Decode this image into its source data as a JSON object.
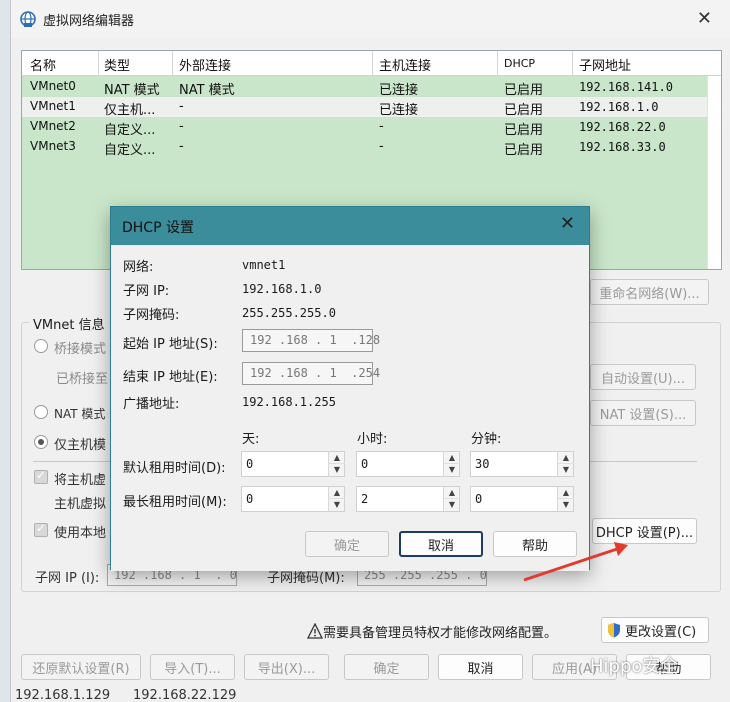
{
  "window": {
    "title": "虚拟网络编辑器",
    "close": "✕"
  },
  "table": {
    "headers": [
      "名称",
      "类型",
      "外部连接",
      "主机连接",
      "DHCP",
      "子网地址"
    ],
    "rows": [
      [
        "VMnet0",
        "NAT 模式",
        "NAT 模式",
        "已连接",
        "已启用",
        "192.168.141.0"
      ],
      [
        "VMnet1",
        "仅主机...",
        "-",
        "已连接",
        "已启用",
        "192.168.1.0"
      ],
      [
        "VMnet2",
        "自定义...",
        "-",
        "-",
        "已启用",
        "192.168.22.0"
      ],
      [
        "VMnet3",
        "自定义...",
        "-",
        "-",
        "已启用",
        "192.168.33.0"
      ]
    ]
  },
  "side_buttons": {
    "rename": "重命名网络(W)...",
    "auto": "自动设置(U)...",
    "nat": "NAT 设置(S)...",
    "dhcp": "DHCP 设置(P)..."
  },
  "vmnet_info": {
    "title": "VMnet 信息",
    "bridge": "桥接模式",
    "bridged_to": "已桥接至",
    "nat": "NAT 模式",
    "host_only": "仅主机模",
    "connect_host": "将主机虚",
    "host_virtual": "主机虚拟",
    "use_local": "使用本地",
    "subnet_ip_label": "子网 IP (I):",
    "subnet_ip_value": "192 .168 . 1  . 0",
    "mask_label": "子网掩码(M):",
    "mask_value": "255 .255 .255 . 0"
  },
  "admin": {
    "notice": "需要具备管理员特权才能修改网络配置。",
    "change": "更改设置(C)"
  },
  "bottom_buttons": {
    "restore": "还原默认设置(R)",
    "import": "导入(T)...",
    "export": "导出(X)...",
    "ok": "确定",
    "cancel": "取消",
    "apply": "应用(A)",
    "help": "帮助"
  },
  "bottom_strip": [
    "192.168.1.129",
    "192.168.22.129"
  ],
  "dhcp": {
    "title": "DHCP 设置",
    "close": "✕",
    "network_label": "网络:",
    "network_value": "vmnet1",
    "subnet_ip_label": "子网 IP:",
    "subnet_ip_value": "192.168.1.0",
    "mask_label": "子网掩码:",
    "mask_value": "255.255.255.0",
    "start_label": "起始 IP 地址(S):",
    "start_value": "192 .168 . 1  .128",
    "end_label": "结束 IP 地址(E):",
    "end_value": "192 .168 . 1  .254",
    "broadcast_label": "广播地址:",
    "broadcast_value": "192.168.1.255",
    "col_days": "天:",
    "col_hours": "小时:",
    "col_minutes": "分钟:",
    "default_lease_label": "默认租用时间(D):",
    "default_days": "0",
    "default_hours": "0",
    "default_minutes": "30",
    "max_lease_label": "最长租用时间(M):",
    "max_days": "0",
    "max_hours": "2",
    "max_minutes": "0",
    "ok": "确定",
    "cancel": "取消",
    "help": "帮助"
  },
  "watermark": "Hippo安全",
  "colors": {
    "table_bg": "#c9e6ca",
    "dialog_title": "#3c8d9b",
    "arrow": "#e23b2e"
  }
}
